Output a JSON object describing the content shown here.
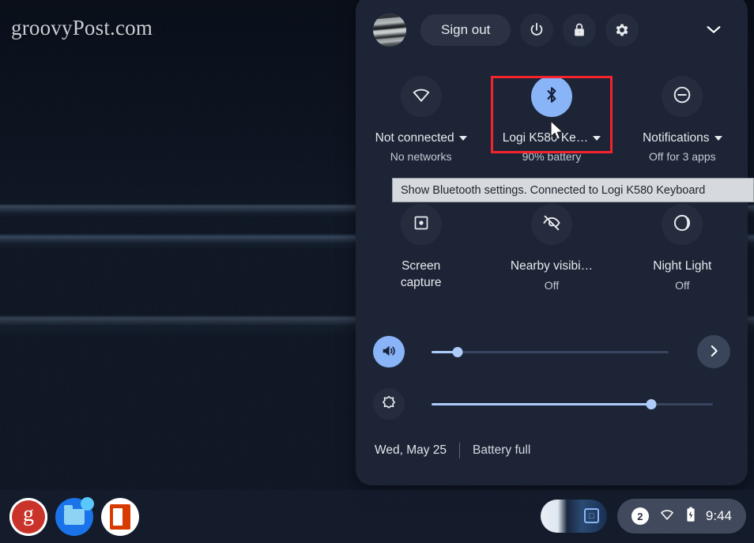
{
  "watermark": "groovyPost.com",
  "quick_settings": {
    "header": {
      "avatar_name": "user-avatar",
      "sign_out_label": "Sign out",
      "power_icon": "power-icon",
      "lock_icon": "lock-icon",
      "settings_icon": "gear-icon",
      "collapse_icon": "chevron-down-icon"
    },
    "tiles_row1": [
      {
        "icon": "wifi-icon",
        "label": "Not connected",
        "sublabel": "No networks",
        "has_caret": true,
        "active": false
      },
      {
        "icon": "bluetooth-icon",
        "label": "Logi K580 Ke…",
        "sublabel": "90% battery",
        "has_caret": true,
        "active": true
      },
      {
        "icon": "do-not-disturb-icon",
        "label": "Notifications",
        "sublabel": "Off for 3 apps",
        "has_caret": true,
        "active": false
      }
    ],
    "tiles_row2": [
      {
        "icon": "screen-capture-icon",
        "label": "Screen\ncapture",
        "sublabel": "",
        "has_caret": false,
        "active": false
      },
      {
        "icon": "nearby-visibility-off-icon",
        "label": "Nearby visibi…",
        "sublabel": "Off",
        "has_caret": false,
        "active": false
      },
      {
        "icon": "night-light-icon",
        "label": "Night Light",
        "sublabel": "Off",
        "has_caret": false,
        "active": false
      }
    ],
    "tooltip": {
      "text": "Show Bluetooth settings. Connected to Logi K580 Keyboard"
    },
    "sliders": {
      "volume": {
        "icon": "volume-icon",
        "value_percent": 11,
        "next_icon": "chevron-right-icon",
        "active": true
      },
      "brightness": {
        "icon": "brightness-icon",
        "value_percent": 78,
        "active": false
      }
    },
    "footer": {
      "date": "Wed, May 25",
      "battery_status": "Battery full"
    },
    "highlight_color": "#f5232c",
    "accent_color": "#8ab4f8",
    "panel_background": "#1c2436"
  },
  "shelf": {
    "apps": [
      {
        "name": "groovypost-app",
        "label": "g",
        "active": false
      },
      {
        "name": "files-app",
        "label": "",
        "active": true,
        "has_badge": true
      },
      {
        "name": "office-app",
        "label": "",
        "active": false
      }
    ],
    "tray": {
      "preview_badge": "□",
      "notification_count": "2",
      "wifi_icon": "wifi-icon",
      "battery_icon": "battery-charging-icon",
      "time": "9:44"
    }
  }
}
